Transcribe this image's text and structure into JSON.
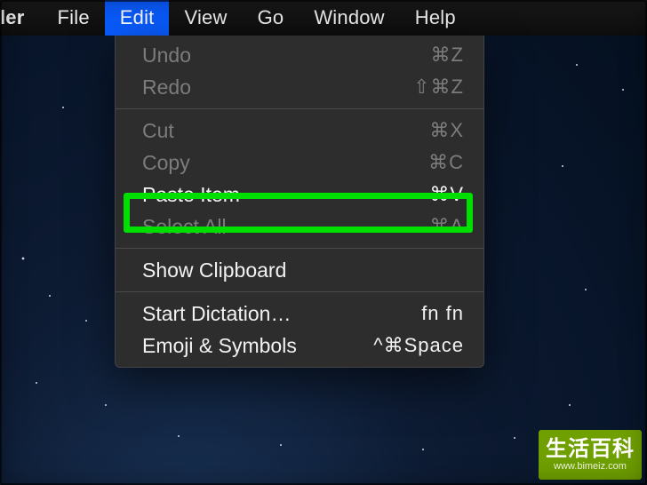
{
  "menubar": {
    "app": "ler",
    "items": [
      "File",
      "Edit",
      "View",
      "Go",
      "Window",
      "Help"
    ],
    "activeIndex": 1
  },
  "dropdown": {
    "sections": [
      [
        {
          "label": "Undo",
          "shortcut": "⌘Z",
          "enabled": false
        },
        {
          "label": "Redo",
          "shortcut": "⇧⌘Z",
          "enabled": false
        }
      ],
      [
        {
          "label": "Cut",
          "shortcut": "⌘X",
          "enabled": false
        },
        {
          "label": "Copy",
          "shortcut": "⌘C",
          "enabled": false
        },
        {
          "label": "Paste Item",
          "shortcut": "⌘V",
          "enabled": true,
          "highlight": true
        },
        {
          "label": "Select All",
          "shortcut": "⌘A",
          "enabled": false
        }
      ],
      [
        {
          "label": "Show Clipboard",
          "shortcut": "",
          "enabled": true
        }
      ],
      [
        {
          "label": "Start Dictation…",
          "shortcut": "fn fn",
          "enabled": true
        },
        {
          "label": "Emoji & Symbols",
          "shortcut": "^⌘Space",
          "enabled": true
        }
      ]
    ]
  },
  "watermark": {
    "line1": "生活百科",
    "line2": "www.bimeiz.com"
  }
}
